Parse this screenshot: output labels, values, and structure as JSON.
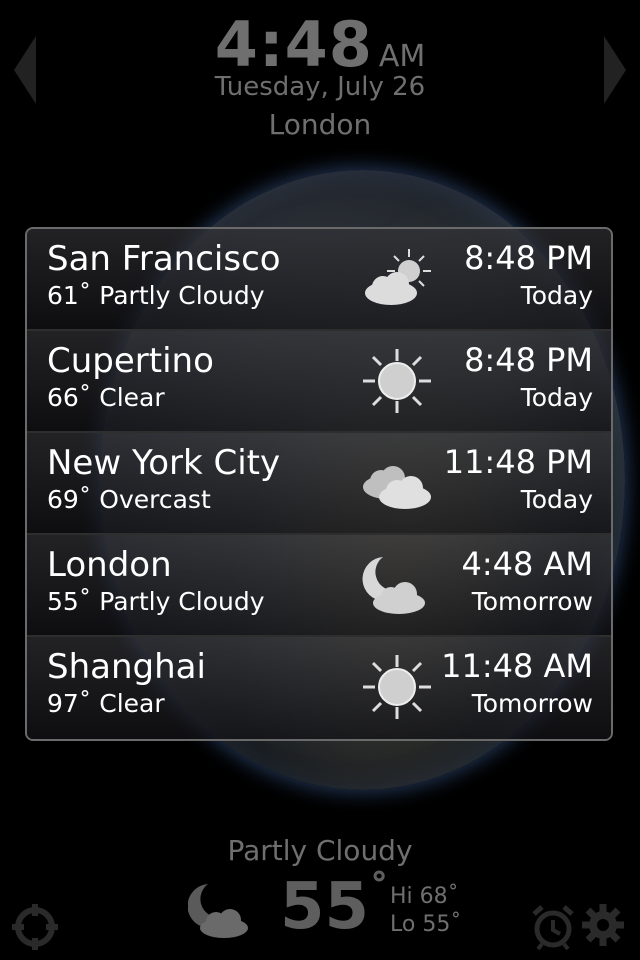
{
  "header": {
    "time": "4:48",
    "ampm": "AM",
    "date": "Tuesday, July 26",
    "city": "London"
  },
  "cities": [
    {
      "name": "San Francisco",
      "temp": "61˚",
      "condition": "Partly Cloudy",
      "time": "8:48 PM",
      "day": "Today",
      "icon": "sun-cloud-icon"
    },
    {
      "name": "Cupertino",
      "temp": "66˚",
      "condition": "Clear",
      "time": "8:48 PM",
      "day": "Today",
      "icon": "sun-icon"
    },
    {
      "name": "New York City",
      "temp": "69˚",
      "condition": "Overcast",
      "time": "11:48 PM",
      "day": "Today",
      "icon": "clouds-icon"
    },
    {
      "name": "London",
      "temp": "55˚",
      "condition": "Partly Cloudy",
      "time": "4:48 AM",
      "day": "Tomorrow",
      "icon": "moon-cloud-icon"
    },
    {
      "name": "Shanghai",
      "temp": "97˚",
      "condition": "Clear",
      "time": "11:48 AM",
      "day": "Tomorrow",
      "icon": "sun-icon"
    }
  ],
  "current": {
    "condition": "Partly Cloudy",
    "temp": "55",
    "degree": "˚",
    "hi": "Hi 68˚",
    "lo": "Lo 55˚"
  },
  "colors": {
    "text_dim": "#6f6f6f",
    "panel_border": "#6a6a6a",
    "glow": "#5a8cdc"
  }
}
